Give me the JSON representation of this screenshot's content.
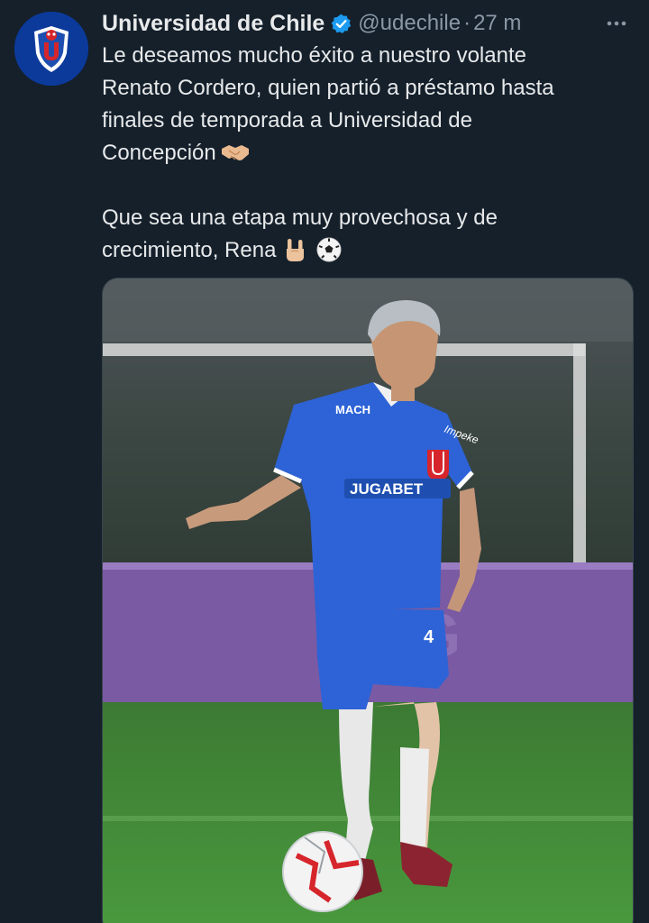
{
  "account": {
    "name": "Universidad de Chile",
    "handle": "@udechile",
    "separator": "·",
    "time": "27 m",
    "avatar_icon": "club-crest-icon",
    "verified_icon": "verified-badge-icon"
  },
  "tweet": {
    "paragraph1": "Le deseamos mucho éxito a nuestro volante\nRenato Cordero, quien partió a préstamo hasta\nfinales de temporada a Universidad de\nConcepción",
    "paragraph1_emoji": "handshake-emoji",
    "paragraph2": "Que sea una etapa muy provechosa y de\ncrecimiento, Rena",
    "paragraph2_emojis": [
      "sign-of-the-horns-emoji",
      "soccer-ball-emoji"
    ]
  },
  "photo": {
    "description_icon": "football-player-photo",
    "jersey_sponsor": "JUGABET",
    "jersey_top_sponsor": "MACH",
    "jersey_brand": "Impeke"
  },
  "colors": {
    "background": "#15202b",
    "text": "#e7e9ea",
    "muted": "#8b98a5",
    "verified": "#1d9bf0",
    "kit_blue": "#2d63d6",
    "pitch_green": "#3f8a36"
  }
}
